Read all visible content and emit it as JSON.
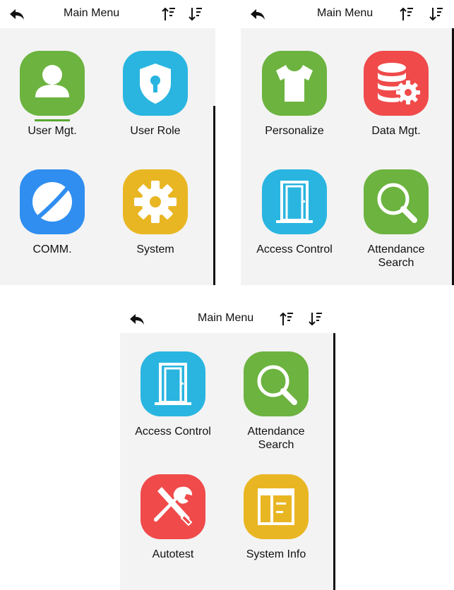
{
  "screens": [
    {
      "title": "Main Menu",
      "tiles": [
        {
          "label": "User Mgt.",
          "icon": "user-icon",
          "color": "#6cb33f",
          "selected": true
        },
        {
          "label": "User Role",
          "icon": "shield-keyhole-icon",
          "color": "#29b5e0",
          "selected": false
        },
        {
          "label": "COMM.",
          "icon": "planet-icon",
          "color": "#2f8ef0",
          "selected": false
        },
        {
          "label": "System",
          "icon": "gear-icon",
          "color": "#e9b623",
          "selected": false
        }
      ]
    },
    {
      "title": "Main Menu",
      "tiles": [
        {
          "label": "Personalize",
          "icon": "tshirt-icon",
          "color": "#6cb33f"
        },
        {
          "label": "Data Mgt.",
          "icon": "database-gear-icon",
          "color": "#f04a4a"
        },
        {
          "label": "Access Control",
          "icon": "door-icon",
          "color": "#29b5e0"
        },
        {
          "label": "Attendance\nSearch",
          "icon": "magnifier-icon",
          "color": "#6cb33f"
        }
      ]
    },
    {
      "title": "Main Menu",
      "tiles": [
        {
          "label": "Access Control",
          "icon": "door-icon",
          "color": "#29b5e0"
        },
        {
          "label": "Attendance\nSearch",
          "icon": "magnifier-icon",
          "color": "#6cb33f"
        },
        {
          "label": "Autotest",
          "icon": "tools-icon",
          "color": "#f04a4a"
        },
        {
          "label": "System Info",
          "icon": "info-panel-icon",
          "color": "#e9b623"
        }
      ]
    }
  ]
}
